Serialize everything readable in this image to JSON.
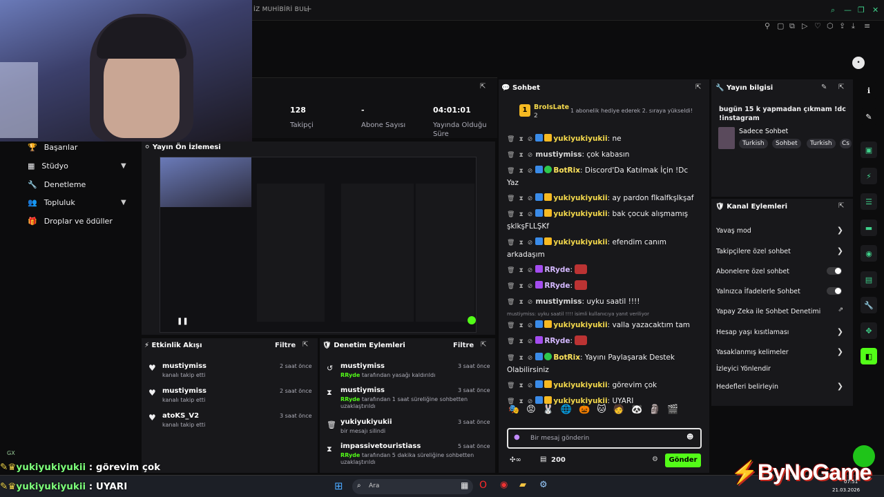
{
  "browser": {
    "tab_title": "İZ MUHİBİRİ BUL",
    "new_tab": "+",
    "toolbar_icons": [
      "search-icon",
      "minimize-icon",
      "restore-icon",
      "close-icon"
    ],
    "ext_icons": [
      "pin-icon",
      "page-icon",
      "screenshot-icon",
      "play-icon",
      "heart-icon",
      "cube-icon",
      "share-icon",
      "download-icon",
      "menu-icon"
    ]
  },
  "stats": {
    "followers_value": "128",
    "followers_label": "Takipçi",
    "subs_value": "-",
    "subs_label": "Abone Sayısı",
    "uptime_value": "04:01:01",
    "uptime_label_1": "Yayında Olduğu",
    "uptime_label_2": "Süre"
  },
  "nav": {
    "items": [
      {
        "label": "Başarılar",
        "icon": "trophy-icon"
      },
      {
        "label": "Stüdyo",
        "icon": "studio-icon"
      },
      {
        "label": "Denetleme",
        "icon": "wrench-icon"
      },
      {
        "label": "Topluluk",
        "icon": "people-icon"
      },
      {
        "label": "Droplar ve ödüller",
        "icon": "gift-icon"
      }
    ]
  },
  "preview": {
    "title": "Yayın Ön İzlemesi"
  },
  "activity": {
    "title": "Etkinlik Akışı",
    "filter": "Filtre",
    "items": [
      {
        "name": "mustiymiss",
        "sub": "kanalı takip etti",
        "time": "2 saat önce"
      },
      {
        "name": "mustiymiss",
        "sub": "kanalı takip etti",
        "time": "2 saat önce"
      },
      {
        "name": "atoKS_V2",
        "sub": "kanalı takip etti",
        "time": "3 saat önce"
      }
    ]
  },
  "mod_actions": {
    "title": "Denetim Eylemleri",
    "filter": "Filtre",
    "items": [
      {
        "name": "mustiymiss",
        "actor": "RRyde",
        "sub": "tarafından yasağı kaldırıldı",
        "sub2": "",
        "time": "3 saat önce"
      },
      {
        "name": "mustiymiss",
        "actor": "RRyde",
        "sub": "tarafından 1 saat süreliğine sohbetten",
        "sub2": "uzaklaştırıldı",
        "time": "3 saat önce"
      },
      {
        "name": "yukiyukiyukii",
        "actor": "",
        "sub": "bir mesajı silindi",
        "sub2": "",
        "time": "3 saat önce"
      },
      {
        "name": "impassivetouristiass",
        "actor": "RRyde",
        "sub": "tarafından 5 dakika süreliğine sohbetten",
        "sub2": "uzaklaştırıldı",
        "time": "5 saat önce"
      }
    ]
  },
  "chat": {
    "title": "Sohbet",
    "gift_user": "BroIsLate",
    "gift_count": "2",
    "gift_text": "1 abonelik hediye ederek 2. sıraya yükseldi!",
    "messages": [
      {
        "user": "yukiyukiyukii",
        "cls": "u-yuki",
        "text": ": ne"
      },
      {
        "user": "mustiymiss",
        "cls": "u-must",
        "text": ": çok kabasın"
      },
      {
        "user": "BotRix",
        "cls": "u-bot",
        "text": ": Discord'Da Katılmak İçin !Dc",
        "text2": "Yaz"
      },
      {
        "user": "yukiyukiyukii",
        "cls": "u-yuki",
        "text": ": ay pardon flkalfkşlkşaf"
      },
      {
        "user": "yukiyukiyukii",
        "cls": "u-yuki",
        "text": ": bak çocuk alışmamış",
        "text2": "şklkşFLLŞKf"
      },
      {
        "user": "yukiyukiyukii",
        "cls": "u-yuki",
        "text": ": efendim canım",
        "text2": "arkadaşım"
      },
      {
        "user": "RRyde",
        "cls": "u-rr",
        "text": ":"
      },
      {
        "user": "RRyde",
        "cls": "u-rr",
        "text": ":"
      },
      {
        "user": "mustiymiss",
        "cls": "u-must",
        "text": ": uyku saatil !!!!"
      },
      {
        "user": "yukiyukiyukii",
        "cls": "u-yuki",
        "text": ": valla yazacaktım tam"
      },
      {
        "user": "RRyde",
        "cls": "u-rr",
        "text": ":"
      },
      {
        "user": "BotRix",
        "cls": "u-bot",
        "text": ": Yayını Paylaşarak Destek",
        "text2": "Olabilirsiniz"
      },
      {
        "user": "yukiyukiyukii",
        "cls": "u-yuki",
        "text": ": görevim çok"
      },
      {
        "user": "yukiyukiyukii",
        "cls": "u-yuki",
        "text": ": UYARI"
      }
    ],
    "reply_note": "mustiymiss: uyku saatil !!!! isimli kullanıcıya yanıt veriliyor",
    "input_placeholder": "Bir mesaj gönderin",
    "points": "200",
    "send": "Gönder"
  },
  "stream_info": {
    "title": "Yayın bilgisi",
    "stream_title": "bugün 15 k yapmadan çıkmam !dc !instagram",
    "category": "Sadece Sohbet",
    "tags": [
      "Turkish",
      "Sohbet",
      "Turkish",
      "Cs"
    ]
  },
  "channel_actions": {
    "title": "Kanal Eylemleri",
    "items": [
      {
        "label": "Yavaş mod",
        "type": "chevron"
      },
      {
        "label": "Takipçilere özel sohbet",
        "type": "chevron"
      },
      {
        "label": "Abonelere özel sohbet",
        "type": "toggle"
      },
      {
        "label": "Yalnızca İfadelerle Sohbet",
        "type": "toggle"
      },
      {
        "label": "Yapay Zeka ile Sohbet Denetimi",
        "type": "external"
      },
      {
        "label": "Hesap yaşı kısıtlaması",
        "type": "chevron"
      },
      {
        "label": "Yasaklanmış kelimeler",
        "type": "chevron"
      },
      {
        "label": "İzleyici Yönlendir",
        "type": "none"
      },
      {
        "label": "Hedefleri belirleyin",
        "type": "chevron"
      }
    ]
  },
  "overlay": {
    "line1_user": "yukiyukiyukii",
    "line1_text": " : görevim çok",
    "line2_user": "yukiyukiyukii",
    "line2_text": " : UYARI",
    "gx": "GX",
    "watermark": "ByNoGame"
  },
  "taskbar": {
    "search": "Ara",
    "time": "07:51",
    "date": "21.03.2026"
  },
  "colors": {
    "accent": "#53fc18",
    "kick_green": "#3fd08a",
    "panel": "#18181b"
  }
}
